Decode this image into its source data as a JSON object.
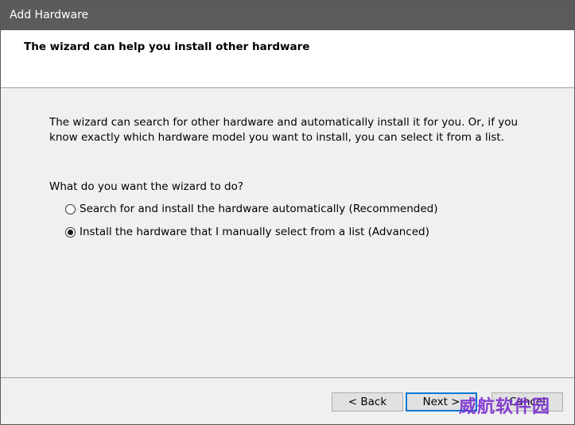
{
  "window": {
    "title": "Add Hardware"
  },
  "header": {
    "title": "The wizard can help you install other hardware"
  },
  "body": {
    "intro": "The wizard can search for other hardware and automatically install it for you. Or, if you know exactly which hardware model you want to install, you can select it from a list.",
    "question": "What do you want the wizard to do?",
    "options": [
      {
        "label": "Search for and install the hardware automatically (Recommended)",
        "selected": false
      },
      {
        "label": "Install the hardware that I manually select from a list (Advanced)",
        "selected": true
      }
    ]
  },
  "buttons": {
    "back": "< Back",
    "next": "Next >",
    "cancel": "Cancel"
  },
  "watermark": {
    "text": "威航软件园"
  },
  "colors": {
    "titlebar": "#5b5b5b",
    "focus_accent": "#0078d7",
    "watermark": "#7b2fd0"
  }
}
